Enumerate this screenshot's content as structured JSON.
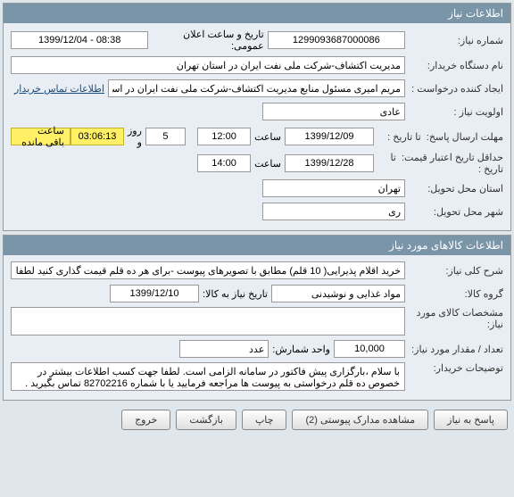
{
  "panel1": {
    "title": "اطلاعات نیاز",
    "need_no_label": "شماره نیاز:",
    "need_no": "1299093687000086",
    "announce_label": "تاریخ و ساعت اعلان عمومی:",
    "announce": "1399/12/04 - 08:38",
    "buyer_org_label": "نام دستگاه خریدار:",
    "buyer_org": "مدیریت اکتشاف-شرکت ملی نفت ایران در استان تهران",
    "creator_label": "ایجاد کننده درخواست :",
    "creator": "مریم امیری مسئول منابع مدیریت اکتشاف-شرکت ملی نفت ایران در استان تهران",
    "buyer_contact_link": "اطلاعات تماس خریدار",
    "priority_label": "اولویت نیاز :",
    "priority": "عادی",
    "deadline_label": "مهلت ارسال پاسخ:",
    "to_date_label": "تا تاریخ :",
    "to_date": "1399/12/09",
    "hour_label": "ساعت",
    "to_time": "12:00",
    "days": "5",
    "days_and_label": "روز و",
    "countdown": "03:06:13",
    "remaining_label": "ساعت باقی مانده",
    "min_credit_label": "حداقل تاریخ اعتبار قیمت:",
    "min_credit_to_label": "تا تاریخ :",
    "min_credit_date": "1399/12/28",
    "min_credit_time": "14:00",
    "delivery_province_label": "استان محل تحویل:",
    "delivery_province": "تهران",
    "delivery_city_label": "شهر محل تحویل:",
    "delivery_city": "ری"
  },
  "panel2": {
    "title": "اطلاعات کالاهای مورد نیاز",
    "need_desc_label": "شرح کلی نیاز:",
    "need_desc": "خرید اقلام پذیرایی( 10 قلم) مطابق با تصویرهای پیوست -برای هر ده قلم قیمت گذاری کنید لطفا",
    "group_label": "گروه کالا:",
    "group": "مواد غذایی و نوشیدنی",
    "need_by_date_label": "تاریخ نیاز به کالا:",
    "need_by_date": "1399/12/10",
    "spec_label": "مشخصات کالای مورد نیاز:",
    "spec": "",
    "qty_label": "تعداد / مقدار مورد نیاز:",
    "qty": "10,000",
    "unit_label": "واحد شمارش:",
    "unit": "عدد",
    "buyer_notes_label": "توضیحات خریدار:",
    "buyer_notes": "با سلام ،بارگزاری پیش فاکتور در سامانه الزامی است. لطفا جهت کسب اطلاعات بیشتر در خصوص ده قلم درخواستی به پیوست ها مراجعه فرمایید یا با شماره 82702216 تماس بگیرید ."
  },
  "buttons": {
    "reply": "پاسخ به نیاز",
    "attachments": "مشاهده مدارک پیوستی (2)",
    "print": "چاپ",
    "back": "بازگشت",
    "exit": "خروج"
  }
}
